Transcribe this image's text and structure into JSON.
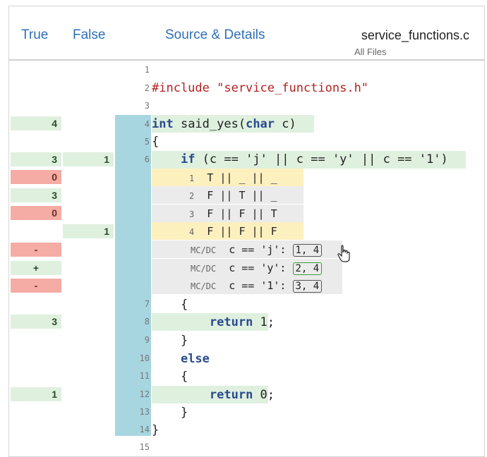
{
  "header": {
    "true_label": "True",
    "false_label": "False",
    "source_label": "Source & Details",
    "filename": "service_functions.c",
    "subtitle": "All Files"
  },
  "lines": [
    {
      "n": "1",
      "text": ""
    },
    {
      "n": "2",
      "text": "#include \"service_functions.h\""
    },
    {
      "n": "3",
      "text": ""
    },
    {
      "n": "4",
      "text": "int said_yes(char c)"
    },
    {
      "n": "5",
      "text": "{"
    },
    {
      "n": "6",
      "text": "    if (c == 'j' || c == 'y' || c == '1')"
    },
    {
      "n": "7",
      "text": "    {"
    },
    {
      "n": "8",
      "text": "        return 1;"
    },
    {
      "n": "9",
      "text": "    }"
    },
    {
      "n": "10",
      "text": "    else"
    },
    {
      "n": "11",
      "text": "    {"
    },
    {
      "n": "12",
      "text": "        return 0;"
    },
    {
      "n": "13",
      "text": "    }"
    },
    {
      "n": "14",
      "text": "}"
    },
    {
      "n": "15",
      "text": ""
    }
  ],
  "counts": {
    "l4_true": "4",
    "l6_true": "3",
    "l6_false": "1",
    "r1_true": "0",
    "r2_true": "3",
    "r3_true": "0",
    "r4_false": "1",
    "m1": "-",
    "m2": "+",
    "m3": "-",
    "l8_true": "3",
    "l12_true": "1"
  },
  "truth_rows": [
    {
      "idx": "1",
      "vals": "T || _ || _"
    },
    {
      "idx": "2",
      "vals": "F || T || _"
    },
    {
      "idx": "3",
      "vals": "F || F || T"
    },
    {
      "idx": "4",
      "vals": "F || F || F"
    }
  ],
  "mcdc": [
    {
      "tag": "MC/DC",
      "cond": "c == 'j':",
      "pair": "1, 4"
    },
    {
      "tag": "MC/DC",
      "cond": "c == 'y':",
      "pair": "2, 4"
    },
    {
      "tag": "MC/DC",
      "cond": "c == '1':",
      "pair": "3, 4"
    }
  ],
  "colors": {
    "covered": "#dff0df",
    "uncovered": "#f4aca4",
    "partial": "#fdf0bf",
    "strip": "#a7d6e0",
    "accent": "#2f6fb6"
  }
}
